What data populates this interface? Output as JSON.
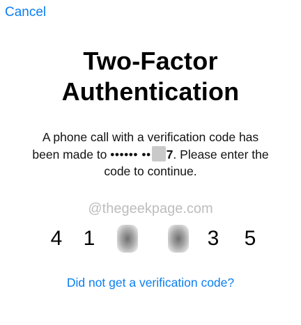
{
  "nav": {
    "cancel_label": "Cancel"
  },
  "title": {
    "line1": "Two-Factor",
    "line2": "Authentication"
  },
  "description": {
    "line1": "A phone call with a verification code has",
    "line2_prefix": "been made to",
    "masked_number": "•••••• ••",
    "last_digit": "7",
    "line2_suffix": ". Please enter the",
    "line3": "code to continue."
  },
  "watermark": "@thegeekpage.com",
  "code": {
    "digits": [
      "4",
      "1",
      "",
      "",
      "3",
      "5"
    ]
  },
  "help_link_label": "Did not get a verification code?",
  "colors": {
    "accent": "#0a7ef0",
    "text": "#000000",
    "watermark": "#bdbdbd"
  }
}
